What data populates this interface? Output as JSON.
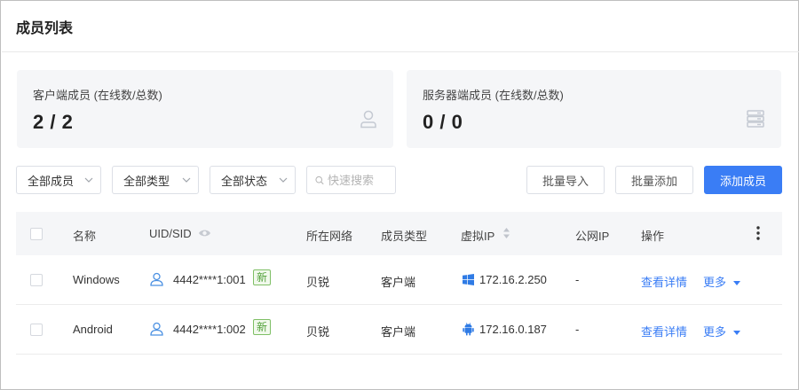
{
  "page": {
    "title": "成员列表"
  },
  "stats": {
    "client": {
      "label": "客户端成员 (在线数/总数)",
      "value": "2 / 2",
      "icon": "user-icon"
    },
    "server": {
      "label": "服务器端成员 (在线数/总数)",
      "value": "0 / 0",
      "icon": "server-icon"
    }
  },
  "filters": {
    "members": "全部成员",
    "types": "全部类型",
    "status": "全部状态",
    "search_placeholder": "快速搜索"
  },
  "actions": {
    "import": "批量导入",
    "batch_add": "批量添加",
    "add_member": "添加成员"
  },
  "colors": {
    "primary": "#3a7df5",
    "badge_green": "#52a13a",
    "header_bg": "#f5f6f8"
  },
  "table": {
    "headers": {
      "name": "名称",
      "uid": "UID/SID",
      "network": "所在网络",
      "member_type": "成员类型",
      "virtual_ip": "虚拟IP",
      "public_ip": "公网IP",
      "actions": "操作"
    },
    "rows": [
      {
        "name": "Windows",
        "uid": "4442****1:001",
        "badge": "新",
        "network": "贝锐",
        "member_type": "客户端",
        "os_icon": "windows-icon",
        "virtual_ip": "172.16.2.250",
        "public_ip": "-",
        "detail_link": "查看详情",
        "more_link": "更多"
      },
      {
        "name": "Android",
        "uid": "4442****1:002",
        "badge": "新",
        "network": "贝锐",
        "member_type": "客户端",
        "os_icon": "android-icon",
        "virtual_ip": "172.16.0.187",
        "public_ip": "-",
        "detail_link": "查看详情",
        "more_link": "更多"
      }
    ]
  }
}
